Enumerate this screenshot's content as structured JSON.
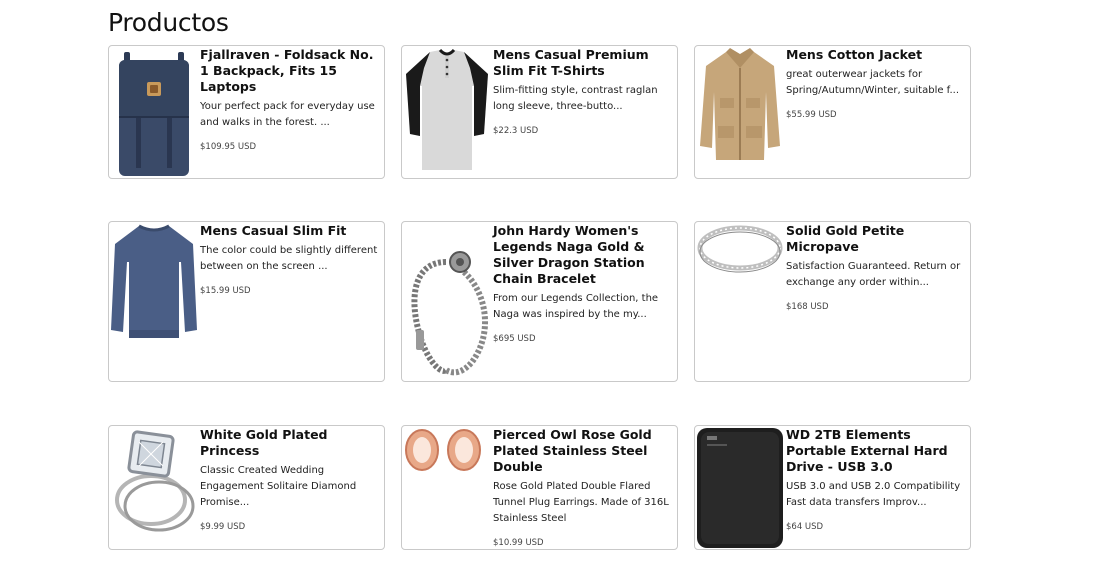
{
  "page": {
    "title": "Productos"
  },
  "products": [
    {
      "name": "Fjallraven - Foldsack No. 1 Backpack, Fits 15 Laptops",
      "description": "Your perfect pack for everyday use and walks in the forest. ...",
      "price": "$109.95 USD",
      "image_icon": "backpack-icon"
    },
    {
      "name": "Mens Casual Premium Slim Fit T-Shirts",
      "description": "Slim-fitting style, contrast raglan long sleeve, three-butto...",
      "price": "$22.3 USD",
      "image_icon": "shirt-icon"
    },
    {
      "name": "Mens Cotton Jacket",
      "description": "great outerwear jackets for Spring/Autumn/Winter, suitable f...",
      "price": "$55.99 USD",
      "image_icon": "jacket-icon"
    },
    {
      "name": "Mens Casual Slim Fit",
      "description": "The color could be slightly different between on the screen ...",
      "price": "$15.99 USD",
      "image_icon": "sweater-icon"
    },
    {
      "name": "John Hardy Women's Legends Naga Gold & Silver Dragon Station Chain Bracelet",
      "description": "From our Legends Collection, the Naga was inspired by the my...",
      "price": "$695 USD",
      "image_icon": "bracelet-icon"
    },
    {
      "name": "Solid Gold Petite Micropave",
      "description": "Satisfaction Guaranteed. Return or exchange any order within...",
      "price": "$168 USD",
      "image_icon": "ring-band-icon"
    },
    {
      "name": "White Gold Plated Princess",
      "description": "Classic Created Wedding Engagement Solitaire Diamond Promise...",
      "price": "$9.99 USD",
      "image_icon": "diamond-ring-icon"
    },
    {
      "name": "Pierced Owl Rose Gold Plated Stainless Steel Double",
      "description": "Rose Gold Plated Double Flared Tunnel Plug Earrings. Made of 316L Stainless Steel",
      "price": "$10.99 USD",
      "image_icon": "earrings-icon"
    },
    {
      "name": "WD 2TB Elements Portable External Hard Drive - USB 3.0",
      "description": "USB 3.0 and USB 2.0 Compatibility Fast data transfers Improv...",
      "price": "$64 USD",
      "image_icon": "hard-drive-icon"
    }
  ]
}
